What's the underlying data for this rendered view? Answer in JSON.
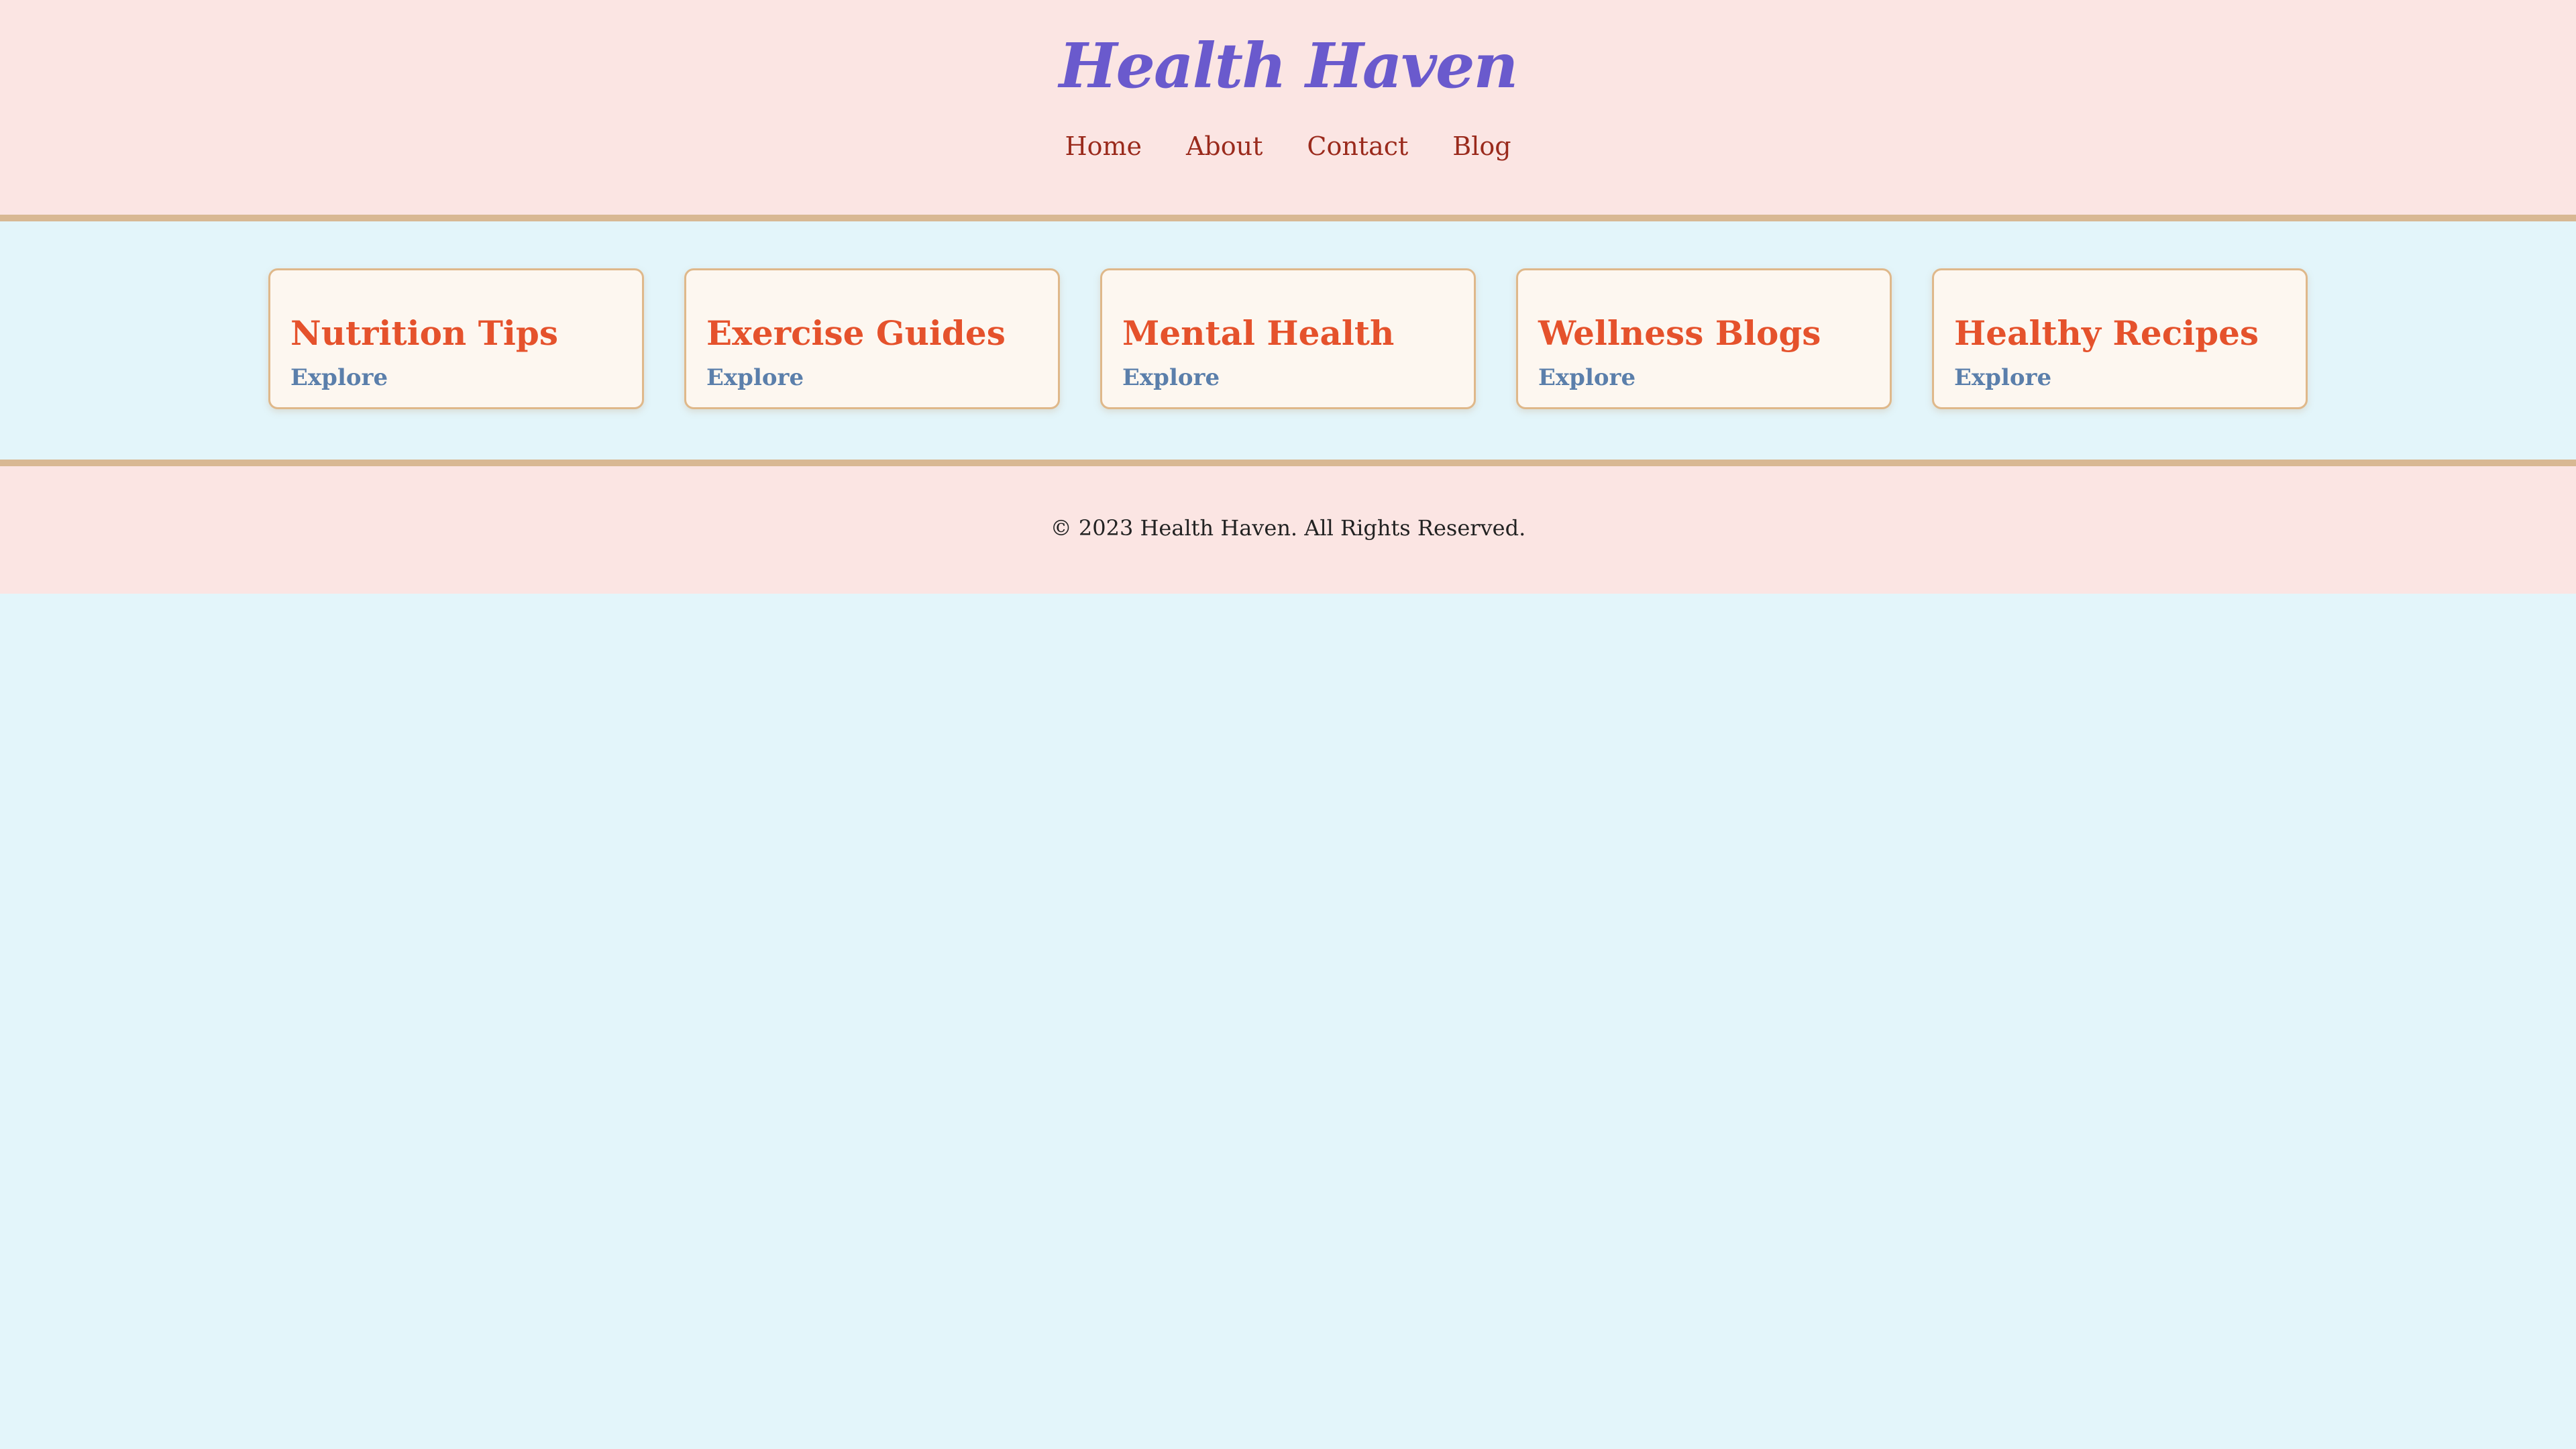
{
  "header": {
    "logo": "Health Haven",
    "nav": [
      {
        "label": "Home"
      },
      {
        "label": "About"
      },
      {
        "label": "Contact"
      },
      {
        "label": "Blog"
      }
    ]
  },
  "cards": [
    {
      "title": "Nutrition Tips",
      "link": "Explore"
    },
    {
      "title": "Exercise Guides",
      "link": "Explore"
    },
    {
      "title": "Mental Health",
      "link": "Explore"
    },
    {
      "title": "Wellness Blogs",
      "link": "Explore"
    },
    {
      "title": "Healthy Recipes",
      "link": "Explore"
    }
  ],
  "footer": {
    "text": "© 2023 Health Haven. All Rights Reserved."
  },
  "colors": {
    "header_bg": "#fbe5e3",
    "page_bg": "#e3f5fa",
    "border": "#d8b893",
    "logo": "#6a5acd",
    "nav_link": "#9a2a1c",
    "card_title": "#e5522c",
    "card_link": "#5b7fab"
  }
}
